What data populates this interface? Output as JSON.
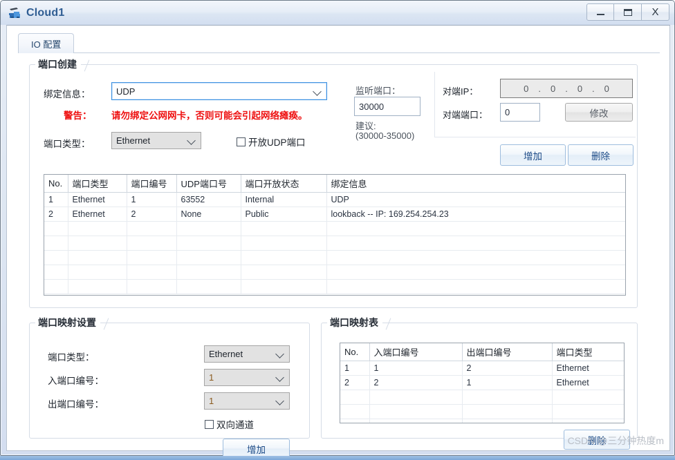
{
  "window": {
    "title": "Cloud1",
    "icon": "cloud-device-icon",
    "controls": {
      "minimize": "–",
      "maximize": "☐",
      "close": "X"
    }
  },
  "tabs": [
    {
      "label": "IO 配置",
      "active": true
    }
  ],
  "port_create": {
    "title": "端口创建",
    "bind_info_label": "绑定信息：",
    "bind_info_value": "UDP",
    "warning_label": "警告：",
    "warning_text": "请勿绑定公网网卡，否则可能会引起网络瘫痪。",
    "port_type_label": "端口类型：",
    "port_type_value": "Ethernet",
    "open_udp_checkbox": "开放UDP端口",
    "open_udp_checked": false,
    "listen_port_label": "监听端口：",
    "listen_port_value": "30000",
    "suggest_label": "建议:",
    "suggest_range": "(30000-35000)",
    "peer_ip_label": "对端IP：",
    "peer_ip_octets": [
      "0",
      "0",
      "0",
      "0"
    ],
    "peer_port_label": "对端端口：",
    "peer_port_value": "0",
    "modify_button": "修改",
    "add_button": "增加",
    "delete_button": "删除"
  },
  "port_table": {
    "columns": [
      "No.",
      "端口类型",
      "端口编号",
      "UDP端口号",
      "端口开放状态",
      "绑定信息"
    ],
    "rows": [
      [
        "1",
        "Ethernet",
        "1",
        "63552",
        "Internal",
        "UDP"
      ],
      [
        "2",
        "Ethernet",
        "2",
        "None",
        "Public",
        "lookback -- IP: 169.254.254.23"
      ]
    ],
    "empty_rows": 5
  },
  "port_map_settings": {
    "title": "端口映射设置",
    "port_type_label": "端口类型：",
    "port_type_value": "Ethernet",
    "in_port_label": "入端口编号：",
    "in_port_value": "1",
    "out_port_label": "出端口编号：",
    "out_port_value": "1",
    "bidirectional_checkbox": "双向通道",
    "bidirectional_checked": false,
    "add_button": "增加"
  },
  "port_map_table": {
    "title": "端口映射表",
    "columns": [
      "No.",
      "入端口编号",
      "出端口编号",
      "端口类型"
    ],
    "rows": [
      [
        "1",
        "1",
        "2",
        "Ethernet"
      ],
      [
        "2",
        "2",
        "1",
        "Ethernet"
      ]
    ],
    "empty_rows": 3,
    "delete_button": "删除"
  },
  "watermark": "CSDN @三分钟热度m",
  "colors": {
    "title_text": "#2f5d93",
    "warning": "#ee1111",
    "button_text": "#1d4b87",
    "focus_border": "#3a8fe0"
  }
}
